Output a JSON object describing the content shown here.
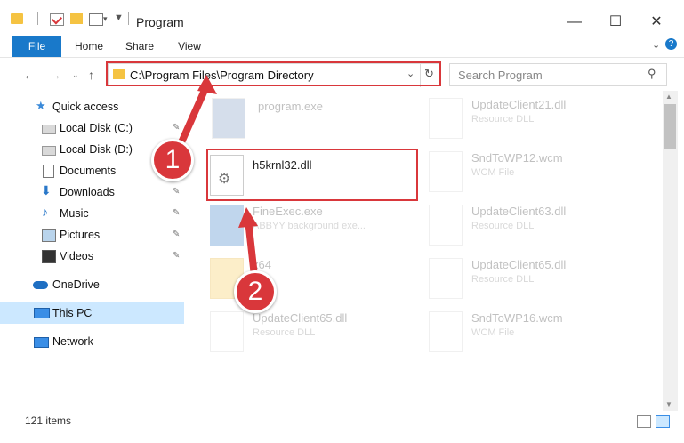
{
  "window": {
    "title": "Program",
    "minimize": "—",
    "maximize": "☐",
    "close": "✕"
  },
  "ribbon": {
    "tabs": [
      "File",
      "Home",
      "Share",
      "View"
    ]
  },
  "address": {
    "path": "C:\\Program Files\\Program Directory",
    "search_placeholder": "Search Program"
  },
  "sidebar": {
    "items": [
      {
        "label": "Quick access"
      },
      {
        "label": "Local Disk (C:)"
      },
      {
        "label": "Local Disk (D:)"
      },
      {
        "label": "Documents"
      },
      {
        "label": "Downloads"
      },
      {
        "label": "Music"
      },
      {
        "label": "Pictures"
      },
      {
        "label": "Videos"
      },
      {
        "label": "OneDrive"
      },
      {
        "label": "This PC"
      },
      {
        "label": "Network"
      }
    ]
  },
  "files": {
    "program": {
      "name": "program.exe"
    },
    "dll": {
      "name": "h5krnl32.dll"
    },
    "fineexec": {
      "name": "FineExec.exe",
      "type": "ABBYY background exe..."
    },
    "folder": {
      "name": "x64"
    },
    "uc65a": {
      "name": "UpdateClient65.dll",
      "type": "Resource DLL"
    },
    "uc21": {
      "name": "UpdateClient21.dll",
      "type": "Resource DLL"
    },
    "snd12": {
      "name": "SndToWP12.wcm",
      "type": "WCM File"
    },
    "uc63": {
      "name": "UpdateClient63.dll",
      "type": "Resource DLL"
    },
    "uc65b": {
      "name": "UpdateClient65.dll",
      "type": "Resource DLL"
    },
    "snd16": {
      "name": "SndToWP16.wcm",
      "type": "WCM File"
    }
  },
  "status": {
    "count": "121 items"
  },
  "annotations": {
    "step1": "1",
    "step2": "2"
  },
  "colors": {
    "accent": "#1979ca",
    "highlight": "#d9373b"
  }
}
